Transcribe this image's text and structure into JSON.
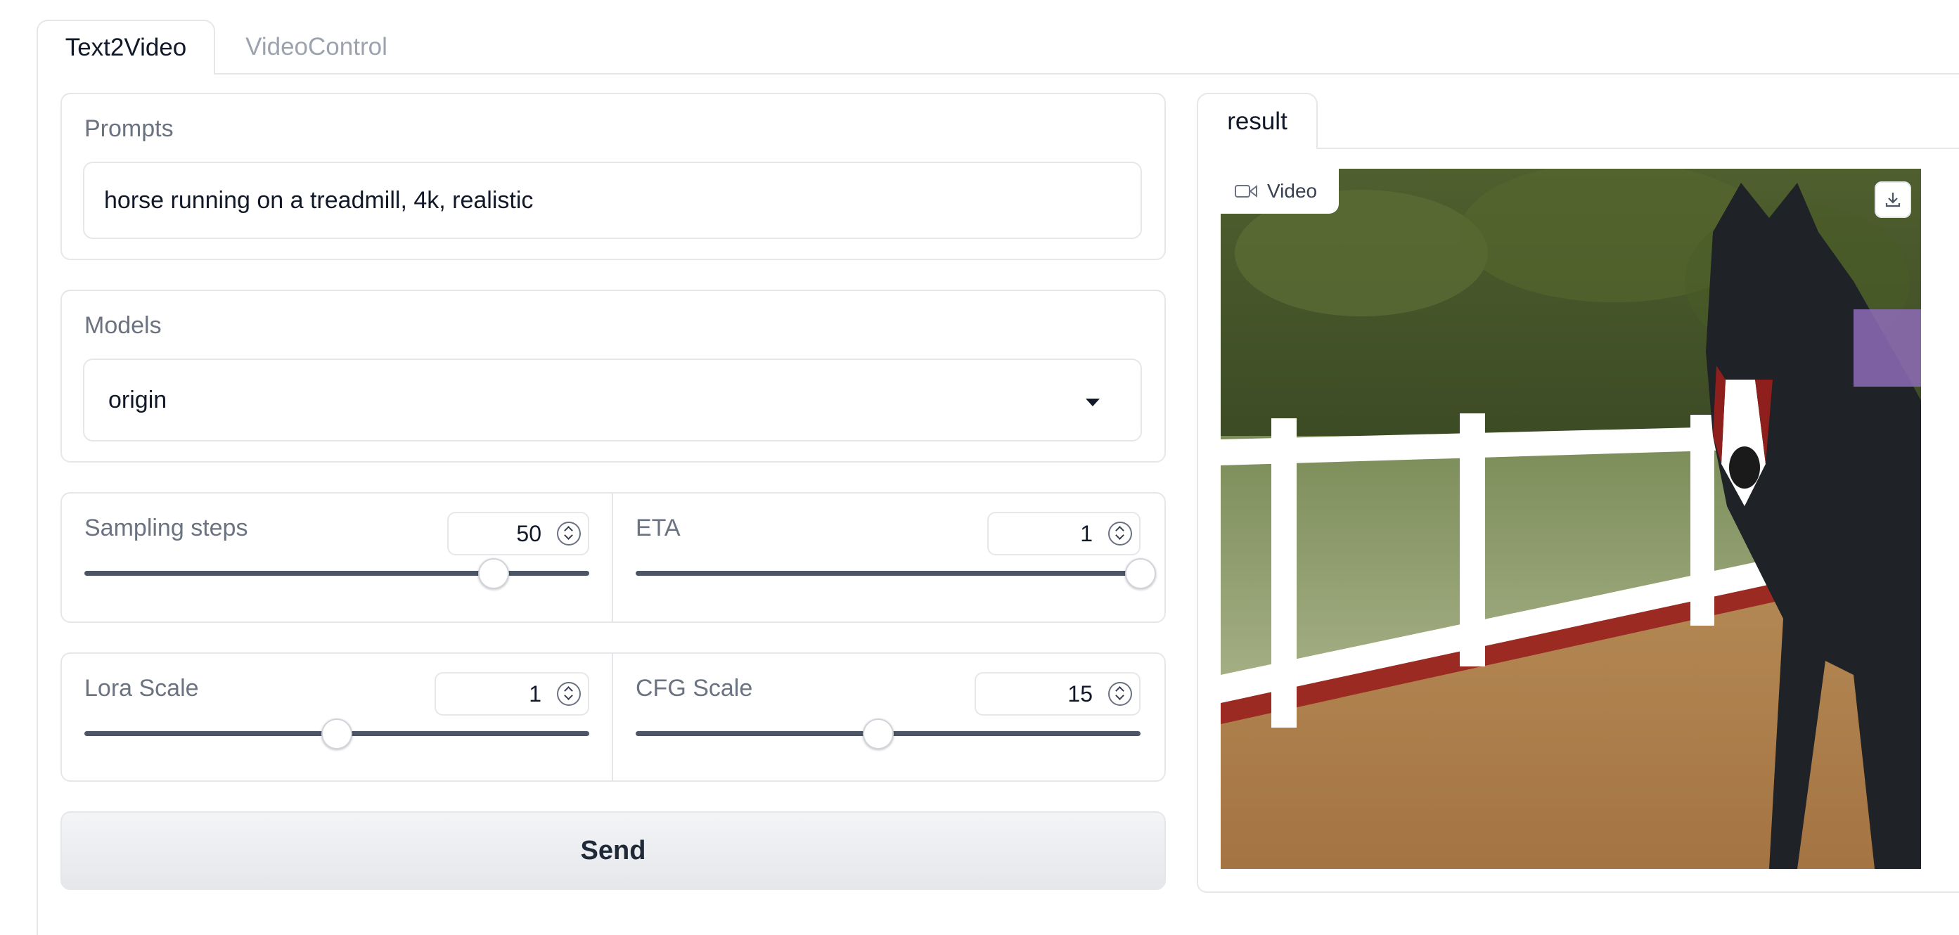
{
  "tabs": [
    {
      "label": "Text2Video",
      "active": true
    },
    {
      "label": "VideoControl",
      "active": false
    }
  ],
  "prompts": {
    "label": "Prompts",
    "value": "horse running on a treadmill, 4k, realistic"
  },
  "models": {
    "label": "Models",
    "selected": "origin"
  },
  "sliders": {
    "sampling_steps": {
      "label": "Sampling steps",
      "value": "50",
      "fraction": 0.81
    },
    "eta": {
      "label": "ETA",
      "value": "1",
      "fraction": 1.0
    },
    "lora_scale": {
      "label": "Lora Scale",
      "value": "1",
      "fraction": 0.5
    },
    "cfg_scale": {
      "label": "CFG Scale",
      "value": "15",
      "fraction": 0.48
    }
  },
  "send_button": {
    "label": "Send"
  },
  "result": {
    "tab_label": "result",
    "video_badge": "Video",
    "video_subject": "horse running on a dirt track beside a white fence"
  },
  "icons": {
    "video": "video-camera-icon",
    "download": "download-icon",
    "dropdown": "chevron-down-icon",
    "spinner": "spinner-arrows-icon"
  },
  "colors": {
    "border": "#e5e7eb",
    "label_text": "#6b7280",
    "inactive_tab": "#9ca3af",
    "slider_track": "#4b5563",
    "button_bg": "#e5e7eb"
  }
}
